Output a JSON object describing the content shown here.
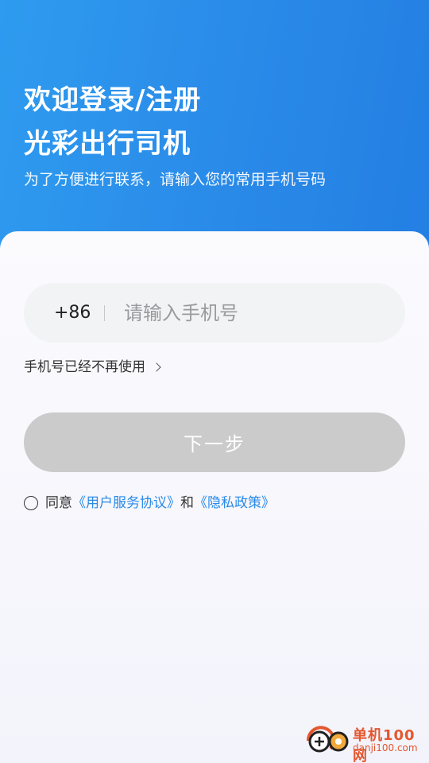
{
  "header": {
    "title_line1": "欢迎登录/注册",
    "title_line2": "光彩出行司机",
    "subtitle": "为了方便进行联系，请输入您的常用手机号码"
  },
  "phone": {
    "country_code": "+86",
    "placeholder": "请输入手机号",
    "value": ""
  },
  "links": {
    "phone_unavailable": "手机号已经不再使用"
  },
  "actions": {
    "next_label": "下一步"
  },
  "agreement": {
    "prefix": "同意",
    "user_agreement": "《用户服务协议》",
    "and": "和",
    "privacy_policy": "《隐私政策》",
    "checked": false
  },
  "watermark": {
    "name": "单机100网",
    "domain": "danji100.com"
  },
  "colors": {
    "accent": "#2a8ae8",
    "button_disabled": "#cbcbcb",
    "input_bg": "#f2f3f5"
  }
}
